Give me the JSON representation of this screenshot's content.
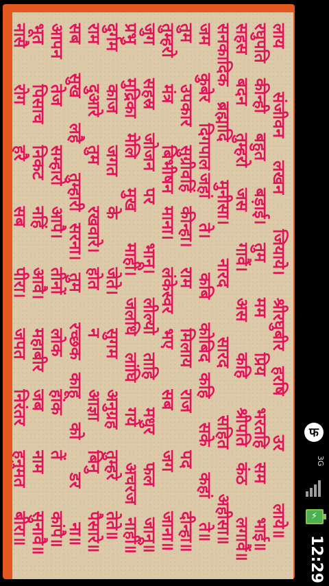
{
  "verses": [
    [
      "लाय",
      "संजीवन",
      "लखन",
      "जियाये।",
      "श्रीरघुबीर",
      "हरषि",
      "उर",
      "लाये॥"
    ],
    [
      "रघुपति",
      "कीन्ही",
      "बहुत",
      "बड़ाई।",
      "तुम",
      "मम",
      "प्रिय",
      "भरतहि",
      "सम",
      "भाई॥"
    ],
    [
      "सहस",
      "बदन",
      "तुम्हरो",
      "जस",
      "गावैं।",
      "अस",
      "कहि",
      "श्रीपति",
      "कंठ",
      "लगावैं॥"
    ],
    [
      "सनकादिक",
      "ब्रह्मादि",
      "मुनीसा।",
      "नारद",
      "सारद",
      "सहित",
      "अहीसा॥"
    ],
    [
      "जम",
      "कुबेर",
      "दिगपाल",
      "जहां",
      "ते।",
      "कबि",
      "कोबिद",
      "कहि",
      "सके",
      "कहां",
      "ते॥"
    ],
    [
      "तुम",
      "उपकार",
      "सुग्रीवहिं",
      "कीन्हा।",
      "राम",
      "मिलाय",
      "राज",
      "पद",
      "दीन्हा॥"
    ],
    [
      "तुम्हरो",
      "मंत्र",
      "बिभीषन",
      "माना।",
      "लंकेस्वर",
      "भए",
      "सब",
      "जग",
      "जाना॥"
    ],
    [
      "जुग",
      "सहस्र",
      "जोजन",
      "पर",
      "भानू।",
      "लील्यो",
      "ताहि",
      "मधुर",
      "फल",
      "जानू॥"
    ],
    [
      "प्रभु",
      "मुद्रिका",
      "मेलि",
      "मुख",
      "माहीं।",
      "जलधि",
      "लांघि",
      "गये",
      "अचरज",
      "नाहीं॥"
    ],
    [
      "दुर्गम",
      "काज",
      "जगत",
      "के",
      "जेते।",
      "सुगम",
      "अनुग्रह",
      "तुम्हरे",
      "तेते॥"
    ],
    [
      "राम",
      "दुआरे",
      "तुम",
      "रखवारे।",
      "होत",
      "न",
      "आज्ञा",
      "बिनु",
      "पैसारे॥"
    ],
    [
      "सब",
      "सुख",
      "लहै",
      "तुम्हारी",
      "सरना।",
      "तुम",
      "रच्छक",
      "काहू",
      "को",
      "डर",
      "ना॥"
    ],
    [
      "आपन",
      "तेज",
      "सम्हारो",
      "आपै।",
      "तीनों",
      "लोक",
      "हांक",
      "तें",
      "कांपै॥"
    ],
    [
      "भूत",
      "पिसाच",
      "निकट",
      "नहिं",
      "आवै।",
      "महाबीर",
      "जब",
      "नाम",
      "सुनावै॥"
    ],
    [
      "नासै",
      "रोग",
      "हरै",
      "सब",
      "पीरा।",
      "जपत",
      "निरंतर",
      "हनुमत",
      "बीरा॥"
    ]
  ],
  "status": {
    "time": "12:29",
    "network": "3G",
    "app_glyph": "फ",
    "icons": [
      "app-icon",
      "network-icon",
      "signal-icon",
      "battery-charging-icon"
    ]
  },
  "colors": {
    "text": "#e0145a",
    "border": "#e2581f",
    "paper": "#dcc9a8"
  }
}
